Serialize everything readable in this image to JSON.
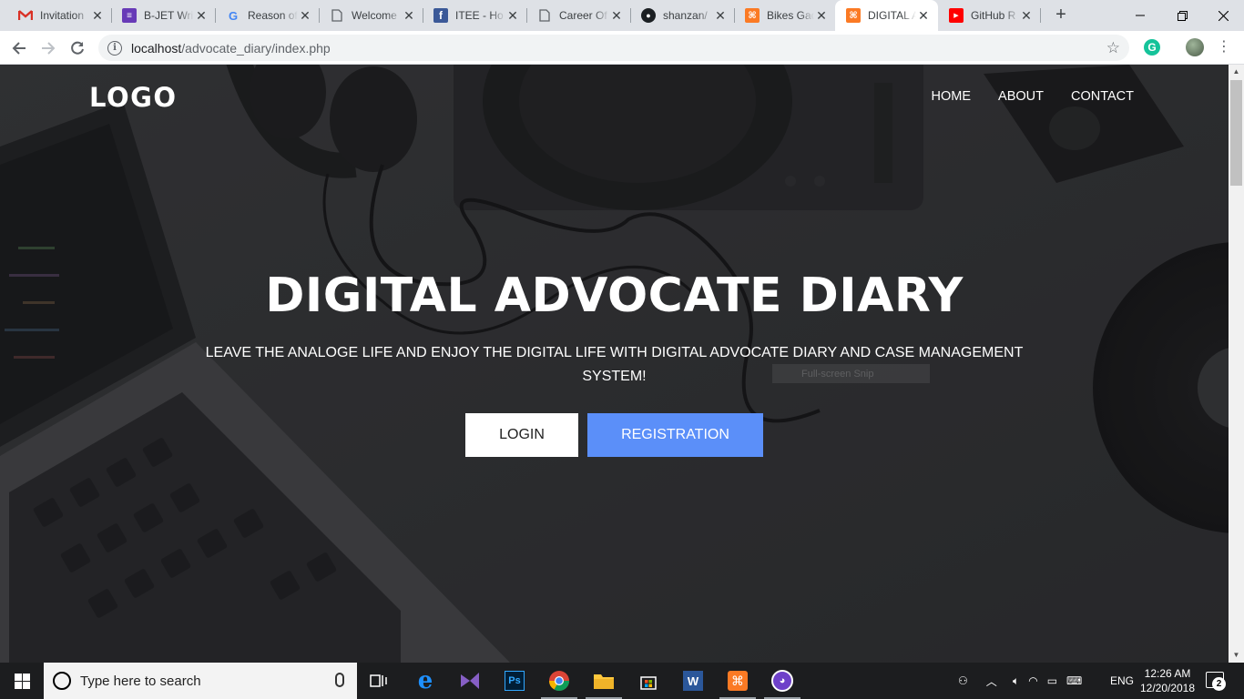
{
  "browser": {
    "tabs": [
      {
        "title": "Invitation",
        "favicon": "gmail-icon"
      },
      {
        "title": "B-JET Writ",
        "favicon": "form-icon"
      },
      {
        "title": "Reason of",
        "favicon": "google-icon"
      },
      {
        "title": "Welcome",
        "favicon": "page-icon"
      },
      {
        "title": "ITEE - Ho",
        "favicon": "facebook-icon"
      },
      {
        "title": "Career Of",
        "favicon": "page-icon"
      },
      {
        "title": "shanzan/",
        "favicon": "github-icon"
      },
      {
        "title": "Bikes Gad",
        "favicon": "xampp-icon"
      },
      {
        "title": "DIGITAL A",
        "favicon": "xampp-icon",
        "active": true
      },
      {
        "title": "GitHub R",
        "favicon": "youtube-icon"
      }
    ],
    "url_host": "localhost",
    "url_path": "/advocate_diary/index.php",
    "extension_label": "G"
  },
  "site": {
    "logo": "LOGO",
    "nav": [
      "HOME",
      "ABOUT",
      "CONTACT"
    ],
    "hero_title": "DIGITAL ADVOCATE DIARY",
    "hero_subtitle": "LEAVE THE ANALOGE LIFE AND ENJOY THE DIGITAL LIFE WITH DIGITAL ADVOCATE DIARY AND CASE MANAGEMENT SYSTEM!",
    "login_label": "LOGIN",
    "register_label": "REGISTRATION",
    "snip_tooltip": "Full-screen Snip",
    "accent": "#5b8ff9"
  },
  "taskbar": {
    "search_placeholder": "Type here to search",
    "language": "ENG",
    "time": "12:26 AM",
    "date": "12/20/2018",
    "notifications": "2"
  }
}
